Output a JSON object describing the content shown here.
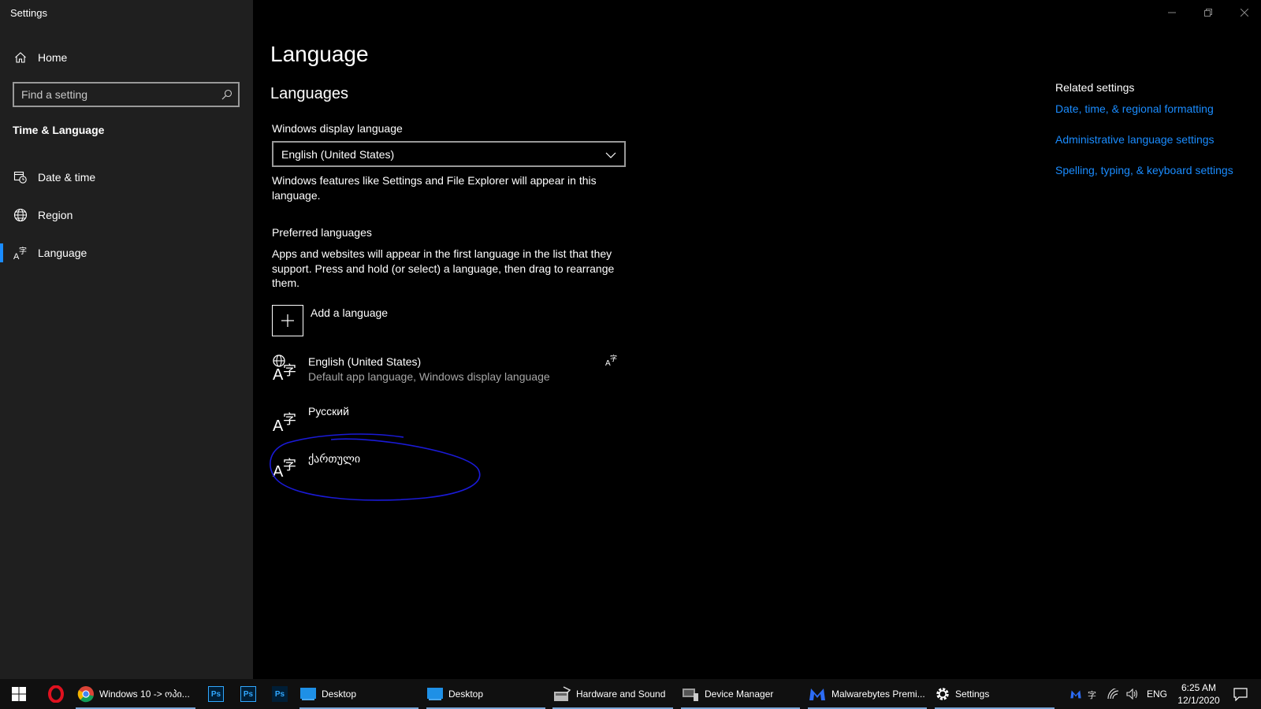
{
  "window": {
    "title": "Settings"
  },
  "sidebar": {
    "home": "Home",
    "search_placeholder": "Find a setting",
    "section": "Time & Language",
    "items": [
      {
        "label": "Date & time",
        "icon": "calendar-clock-icon"
      },
      {
        "label": "Region",
        "icon": "globe-icon"
      },
      {
        "label": "Language",
        "icon": "language-icon",
        "active": true
      }
    ]
  },
  "main": {
    "title": "Language",
    "subtitle": "Languages",
    "display_language_label": "Windows display language",
    "display_language_value": "English (United States)",
    "display_language_desc": "Windows features like Settings and File Explorer will appear in this language.",
    "preferred_label": "Preferred languages",
    "preferred_desc": "Apps and websites will appear in the first language in the list that they support. Press and hold (or select) a language, then drag to rearrange them.",
    "add_language": "Add a language",
    "languages": [
      {
        "name": "English (United States)",
        "sub": "Default app language, Windows display language"
      },
      {
        "name": "Русский",
        "sub": ""
      },
      {
        "name": "ქართული",
        "sub": ""
      }
    ]
  },
  "related": {
    "title": "Related settings",
    "links": [
      "Date, time, & regional formatting",
      "Administrative language settings",
      "Spelling, typing, & keyboard settings"
    ]
  },
  "taskbar": {
    "items": [
      "Windows 10 -> ოპი...",
      "Desktop",
      "Desktop",
      "Hardware and Sound",
      "Device Manager",
      "Malwarebytes Premi...",
      "Settings"
    ],
    "ps_label": "Ps",
    "input_lang": "ENG",
    "time": "6:25 AM",
    "date": "12/1/2020"
  },
  "colors": {
    "accent": "#1a8cff",
    "sidebar_bg": "#1f1f1f",
    "annotation": "#1a1ad6"
  }
}
